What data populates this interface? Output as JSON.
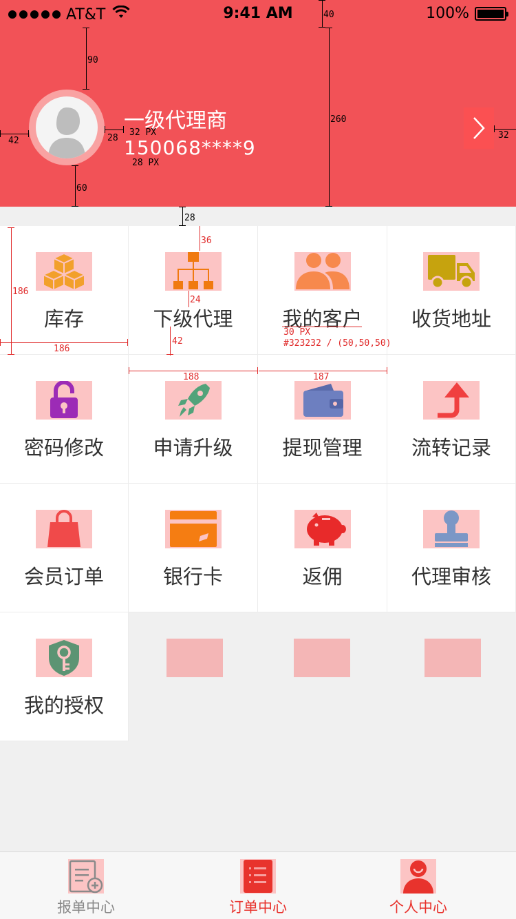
{
  "status_bar": {
    "carrier": "AT&T",
    "time": "9:41 AM",
    "battery": "100%",
    "battery_level": 1.0
  },
  "profile": {
    "name": "一级代理商",
    "phone": "150068****9"
  },
  "annotations": {
    "a40": "40",
    "a90": "90",
    "a260": "260",
    "a42": "42",
    "a28_left": "28",
    "a32px": "32 PX",
    "a28px": "28 PX",
    "a60": "60",
    "a32": "32",
    "a28_gap": "28",
    "a186_v": "186",
    "a186_h": "186",
    "a36": "36",
    "a24": "24",
    "a42_b": "42",
    "a30px": "30 PX",
    "a_color": "#323232 / (50,50,50)",
    "a188": "188",
    "a187": "187"
  },
  "grid": [
    {
      "label": "库存",
      "icon": "boxes-icon"
    },
    {
      "label": "下级代理",
      "icon": "org-chart-icon"
    },
    {
      "label": "我的客户",
      "icon": "customers-icon"
    },
    {
      "label": "收货地址",
      "icon": "truck-icon"
    },
    {
      "label": "密码修改",
      "icon": "lock-icon"
    },
    {
      "label": "申请升级",
      "icon": "rocket-icon"
    },
    {
      "label": "提现管理",
      "icon": "wallet-icon"
    },
    {
      "label": "流转记录",
      "icon": "arrow-turn-icon"
    },
    {
      "label": "会员订单",
      "icon": "shopping-bag-icon"
    },
    {
      "label": "银行卡",
      "icon": "bank-card-icon"
    },
    {
      "label": "返佣",
      "icon": "piggy-bank-icon"
    },
    {
      "label": "代理审核",
      "icon": "stamp-icon"
    },
    {
      "label": "我的授权",
      "icon": "key-shield-icon"
    }
  ],
  "tabs": [
    {
      "label": "报单中心",
      "icon": "report-form-icon",
      "color": "#8a8a8a"
    },
    {
      "label": "订单中心",
      "icon": "order-list-icon",
      "color": "#e8332d"
    },
    {
      "label": "个人中心",
      "icon": "person-icon",
      "color": "#e8332d"
    }
  ],
  "colors": {
    "header": "#f25257",
    "text": "#323232",
    "accent": "#e8332d"
  }
}
